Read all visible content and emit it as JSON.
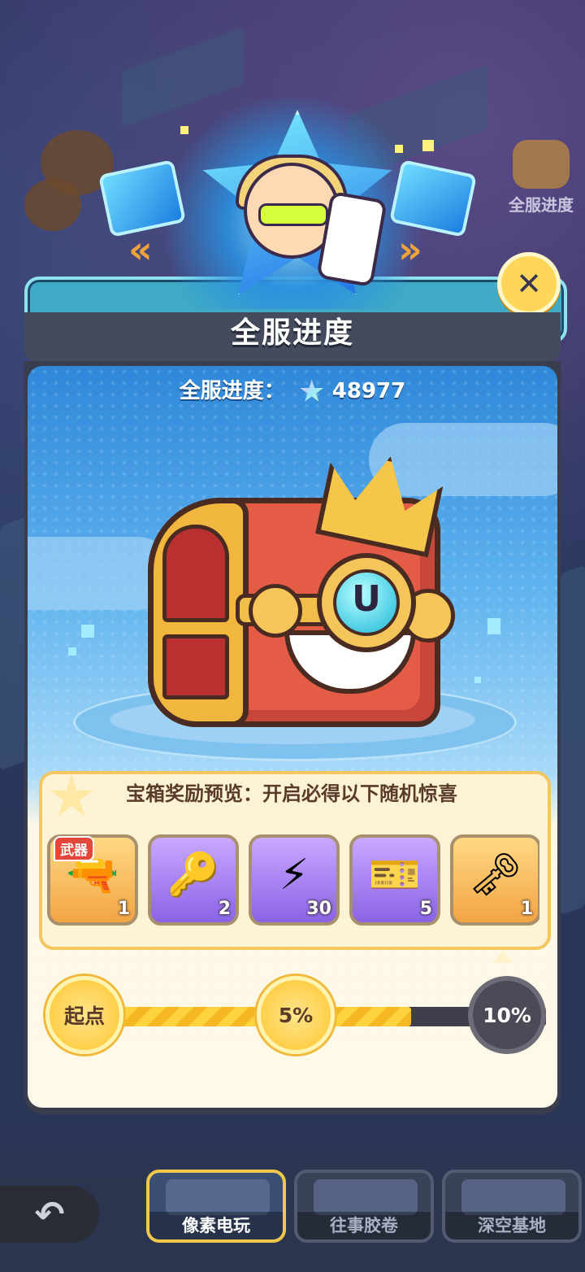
{
  "panel": {
    "title": "全服进度",
    "progress_label": "全服进度：",
    "progress_value": "48977",
    "progress_icon": "rainbow-star-bottle-icon"
  },
  "side_entries": [
    {
      "label": "全服进度",
      "icon": "crown-chest-icon"
    }
  ],
  "chest": {
    "icon": "crown-treasure-chest-icon"
  },
  "rewards": {
    "header": "宝箱奖励预览：开启必得以下随机惊喜",
    "items": [
      {
        "icon": "weapon-ray-gun-icon",
        "glyph": "🔫",
        "count": "1",
        "tag": "武器",
        "style": "gold"
      },
      {
        "icon": "purple-key-icon",
        "glyph": "🔑",
        "count": "2",
        "tag": "",
        "style": "purple"
      },
      {
        "icon": "lightning-bolt-icon",
        "glyph": "⚡",
        "count": "30",
        "tag": "",
        "style": "purple"
      },
      {
        "icon": "ticket-card-icon",
        "glyph": "🎫",
        "count": "5",
        "tag": "",
        "style": "purple"
      },
      {
        "icon": "star-moon-key-icon",
        "glyph": "🗝",
        "count": "1",
        "tag": "",
        "style": "gold"
      }
    ]
  },
  "progress": {
    "fill_fraction": 0.7,
    "nodes": [
      {
        "label": "起点",
        "state": "reached"
      },
      {
        "label": "5%",
        "state": "reached"
      },
      {
        "label": "10%",
        "state": "locked"
      }
    ]
  },
  "nav": {
    "back_icon": "back-arrow-icon",
    "tabs": [
      {
        "label": "像素电玩",
        "active": true
      },
      {
        "label": "往事胶卷",
        "active": false
      },
      {
        "label": "深空基地",
        "active": false
      }
    ]
  },
  "colors": {
    "accent_gold": "#ffd23f",
    "panel_sky": "#2f87d8",
    "cream": "#fff3d6"
  }
}
